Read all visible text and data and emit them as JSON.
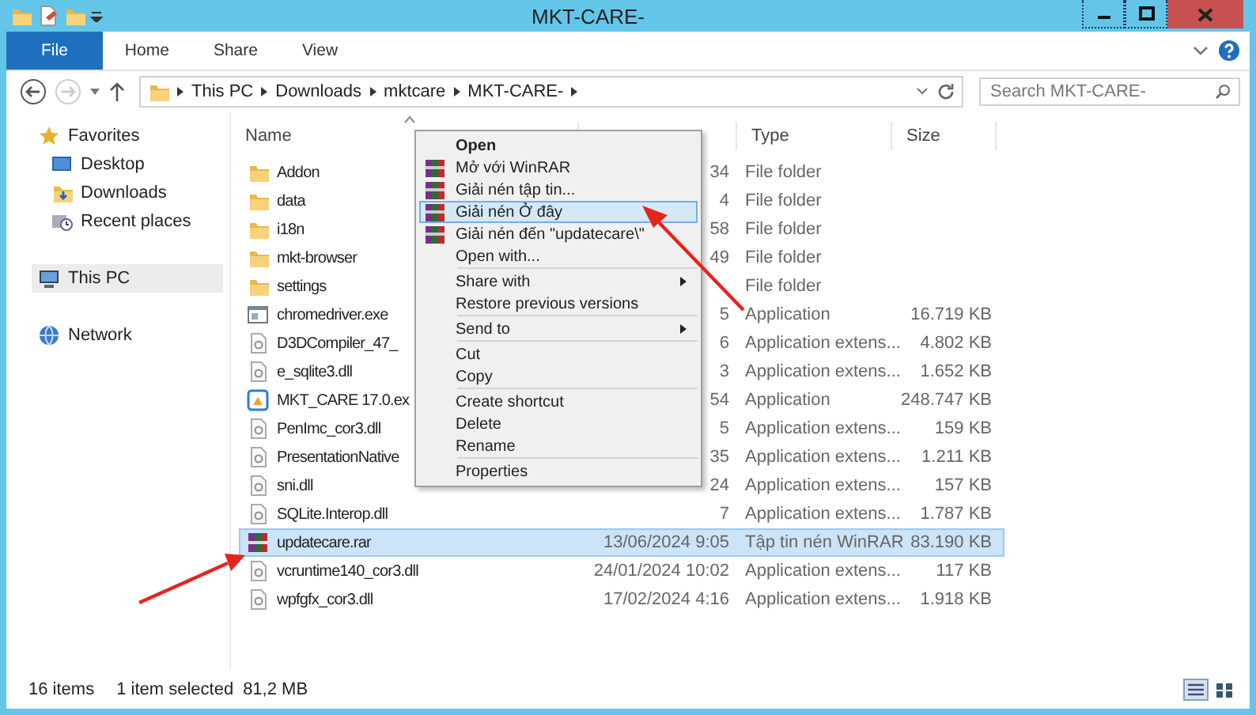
{
  "window": {
    "title": "MKT-CARE-"
  },
  "ribbon": {
    "tabs": [
      {
        "label": "File",
        "kind": "file",
        "selected": false
      },
      {
        "label": "Home",
        "kind": "tab",
        "selected": false
      },
      {
        "label": "Share",
        "kind": "tab",
        "selected": false
      },
      {
        "label": "View",
        "kind": "tab",
        "selected": false
      }
    ]
  },
  "navigation": {
    "back_disabled": false,
    "forward_disabled": true,
    "path": [
      "This PC",
      "Downloads",
      "mktcare",
      "MKT-CARE-"
    ],
    "search": {
      "placeholder": "Search MKT-CARE-"
    }
  },
  "sidebar": {
    "items": [
      {
        "label": "Favorites",
        "kind": "star",
        "selected": false,
        "children": [
          {
            "label": "Desktop",
            "kind": "desktop",
            "selected": false
          },
          {
            "label": "Downloads",
            "kind": "downloads",
            "selected": false
          },
          {
            "label": "Recent places",
            "kind": "recent",
            "selected": false
          }
        ]
      },
      {
        "label": "This PC",
        "kind": "computer",
        "selected": true
      },
      {
        "label": "Network",
        "kind": "network",
        "selected": false
      }
    ]
  },
  "file_list": {
    "headers": {
      "name": "Name",
      "type": "Type",
      "size": "Size"
    },
    "sort_ascending": true,
    "rows": [
      {
        "name": "Addon",
        "date": "34",
        "type": "File folder",
        "kind": "folder",
        "selected": false
      },
      {
        "name": "data",
        "date": "4",
        "type": "File folder",
        "kind": "folder",
        "selected": false
      },
      {
        "name": "i18n",
        "date": "58",
        "type": "File folder",
        "kind": "folder",
        "selected": false
      },
      {
        "name": "mkt-browser",
        "date": "49",
        "type": "File folder",
        "kind": "folder",
        "selected": false
      },
      {
        "name": "settings",
        "type": "File folder",
        "kind": "folder",
        "selected": false
      },
      {
        "name": "chromedriver.exe",
        "date": "5",
        "type": "Application",
        "size": "16.719 KB",
        "kind": "exe",
        "selected": false
      },
      {
        "name": "D3DCompiler_47_",
        "date": "6",
        "type": "Application extens...",
        "size": "4.802 KB",
        "kind": "dll",
        "selected": false
      },
      {
        "name": "e_sqlite3.dll",
        "date": "3",
        "type": "Application extens...",
        "size": "1.652 KB",
        "kind": "dll",
        "selected": false
      },
      {
        "name": "MKT_CARE 17.0.ex",
        "date": "54",
        "type": "Application",
        "size": "248.747 KB",
        "kind": "app",
        "selected": false
      },
      {
        "name": "PenImc_cor3.dll",
        "date": "5",
        "type": "Application extens...",
        "size": "159 KB",
        "kind": "dll",
        "selected": false
      },
      {
        "name": "PresentationNative",
        "date": "35",
        "type": "Application extens...",
        "size": "1.211 KB",
        "kind": "dll",
        "selected": false
      },
      {
        "name": "sni.dll",
        "date": "24",
        "type": "Application extens...",
        "size": "157 KB",
        "kind": "dll",
        "selected": false
      },
      {
        "name": "SQLite.Interop.dll",
        "date": "7",
        "type": "Application extens...",
        "size": "1.787 KB",
        "kind": "dll",
        "selected": false
      },
      {
        "name": "updatecare.rar",
        "date": "13/06/2024 9:05",
        "type": "Tập tin nén WinRAR",
        "size": "83.190 KB",
        "kind": "rar",
        "selected": true
      },
      {
        "name": "vcruntime140_cor3.dll",
        "date": "24/01/2024 10:02",
        "type": "Application extens...",
        "size": "117 KB",
        "kind": "dll",
        "selected": false
      },
      {
        "name": "wpfgfx_cor3.dll",
        "date": "17/02/2024 4:16",
        "type": "Application extens...",
        "size": "1.918 KB",
        "kind": "dll",
        "selected": false
      }
    ]
  },
  "context_menu": {
    "items": [
      {
        "kind": "item",
        "label": "Open",
        "bold": true,
        "icon": false,
        "submenu": false,
        "selected": false
      },
      {
        "kind": "item",
        "label": "Mở với WinRAR",
        "bold": false,
        "icon": true,
        "submenu": false,
        "selected": false
      },
      {
        "kind": "item",
        "label": "Giải nén tập tin...",
        "bold": false,
        "icon": true,
        "submenu": false,
        "selected": false
      },
      {
        "kind": "item",
        "label": "Giải nén Ở đây",
        "bold": false,
        "icon": true,
        "submenu": false,
        "selected": true
      },
      {
        "kind": "item",
        "label": "Giải nén đến \"updatecare\\\"",
        "bold": false,
        "icon": true,
        "submenu": false,
        "selected": false
      },
      {
        "kind": "item",
        "label": "Open with...",
        "bold": false,
        "icon": false,
        "submenu": false,
        "selected": false
      },
      {
        "kind": "separator"
      },
      {
        "kind": "item",
        "label": "Share with",
        "bold": false,
        "icon": false,
        "submenu": true,
        "selected": false
      },
      {
        "kind": "item",
        "label": "Restore previous versions",
        "bold": false,
        "icon": false,
        "submenu": false,
        "selected": false
      },
      {
        "kind": "separator"
      },
      {
        "kind": "item",
        "label": "Send to",
        "bold": false,
        "icon": false,
        "submenu": true,
        "selected": false
      },
      {
        "kind": "separator"
      },
      {
        "kind": "item",
        "label": "Cut",
        "bold": false,
        "icon": false,
        "submenu": false,
        "selected": false
      },
      {
        "kind": "item",
        "label": "Copy",
        "bold": false,
        "icon": false,
        "submenu": false,
        "selected": false
      },
      {
        "kind": "separator"
      },
      {
        "kind": "item",
        "label": "Create shortcut",
        "bold": false,
        "icon": false,
        "submenu": false,
        "selected": false
      },
      {
        "kind": "item",
        "label": "Delete",
        "bold": false,
        "icon": false,
        "submenu": false,
        "selected": false
      },
      {
        "kind": "item",
        "label": "Rename",
        "bold": false,
        "icon": false,
        "submenu": false,
        "selected": false
      },
      {
        "kind": "separator"
      },
      {
        "kind": "item",
        "label": "Properties",
        "bold": false,
        "icon": false,
        "submenu": false,
        "selected": false
      }
    ]
  },
  "status_bar": {
    "item_count": "16 items",
    "selection": "1 item selected",
    "selection_size": "81,2 MB",
    "views": [
      {
        "kind": "details",
        "selected": true
      },
      {
        "kind": "tiles",
        "selected": false
      }
    ]
  }
}
